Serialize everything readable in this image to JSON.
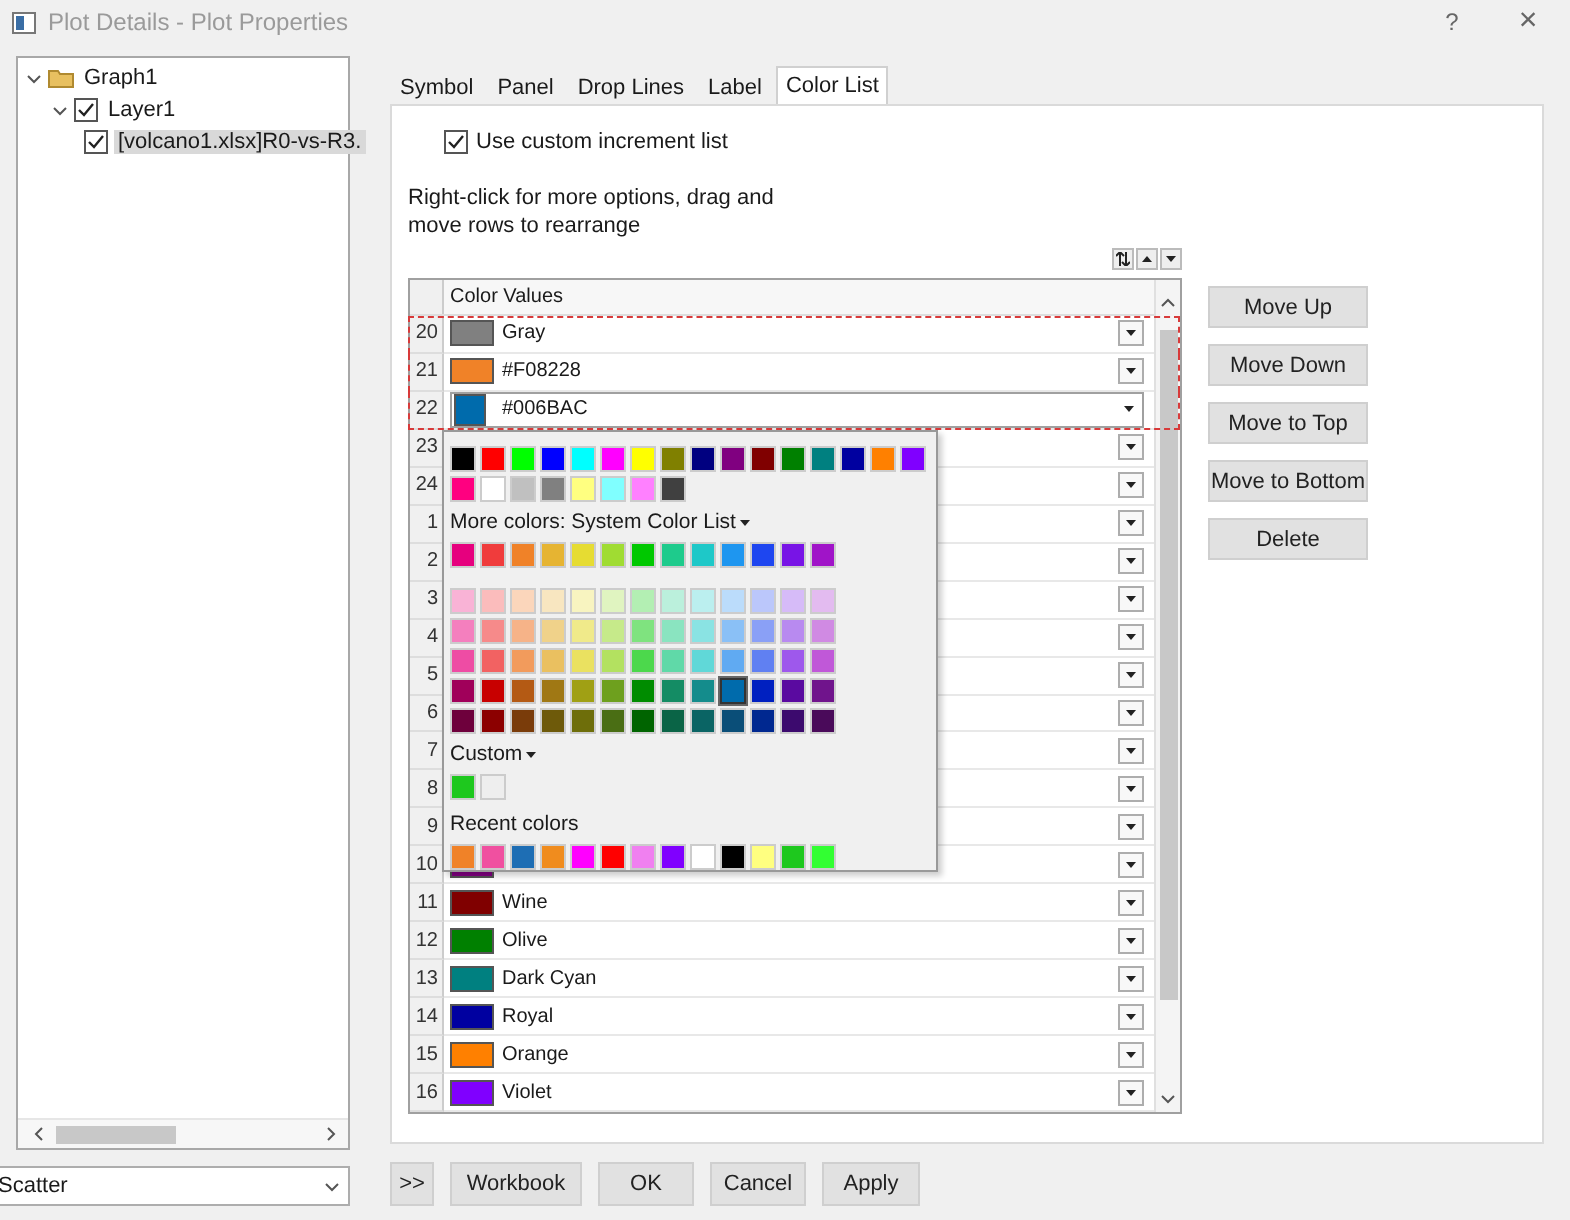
{
  "window": {
    "title": "Plot Details - Plot Properties",
    "buttons": [
      {
        "kind": "help",
        "label": "?"
      },
      {
        "kind": "close",
        "label": "×"
      }
    ]
  },
  "tree": [
    {
      "label": "Graph1",
      "kind": "folder",
      "expanded": true,
      "selected": false,
      "children": [
        {
          "label": "Layer1",
          "kind": "check",
          "checked": true,
          "expanded": true,
          "selected": false,
          "children": [
            {
              "label": "[volcano1.xlsx]R0-vs-R3.",
              "kind": "check",
              "checked": true,
              "selected": true
            }
          ]
        }
      ]
    }
  ],
  "plot_type": {
    "value": "Scatter"
  },
  "tabs": [
    {
      "label": "Symbol",
      "selected": false
    },
    {
      "label": "Panel",
      "selected": false
    },
    {
      "label": "Drop Lines",
      "selected": false
    },
    {
      "label": "Label",
      "selected": false
    },
    {
      "label": "Color List",
      "selected": true
    }
  ],
  "use_custom_increment": {
    "label": "Use custom increment list",
    "checked": true
  },
  "hint": "Right-click for more options, drag and move rows to rearrange",
  "table": {
    "header": "Color Values",
    "rows": [
      {
        "number": "20",
        "name": "Gray",
        "color": "#808080",
        "selected": true,
        "open": false
      },
      {
        "number": "21",
        "name": "#F08228",
        "color": "#f08228",
        "selected": true,
        "open": false
      },
      {
        "number": "22",
        "name": "#006BAC",
        "color": "#006bac",
        "selected": true,
        "open": true
      },
      {
        "number": "23",
        "selected": false,
        "open": false
      },
      {
        "number": "24",
        "selected": false,
        "open": false
      },
      {
        "number": "1",
        "selected": false,
        "open": false
      },
      {
        "number": "2",
        "selected": false,
        "open": false
      },
      {
        "number": "3",
        "selected": false,
        "open": false
      },
      {
        "number": "4",
        "selected": false,
        "open": false
      },
      {
        "number": "5",
        "selected": false,
        "open": false
      },
      {
        "number": "6",
        "selected": false,
        "open": false
      },
      {
        "number": "7",
        "selected": false,
        "open": false
      },
      {
        "number": "8",
        "selected": false,
        "open": false
      },
      {
        "number": "9",
        "selected": false,
        "open": false
      },
      {
        "number": "10",
        "color": "#800080",
        "selected": false,
        "open": false
      },
      {
        "number": "11",
        "name": "Wine",
        "color": "#800000",
        "selected": false,
        "open": false
      },
      {
        "number": "12",
        "name": "Olive",
        "color": "#008000",
        "selected": false,
        "open": false
      },
      {
        "number": "13",
        "name": "Dark Cyan",
        "color": "#008080",
        "selected": false,
        "open": false
      },
      {
        "number": "14",
        "name": "Royal",
        "color": "#0000a0",
        "selected": false,
        "open": false
      },
      {
        "number": "15",
        "name": "Orange",
        "color": "#ff8000",
        "selected": false,
        "open": false
      },
      {
        "number": "16",
        "name": "Violet",
        "color": "#8000ff",
        "selected": false,
        "open": false
      }
    ]
  },
  "color_popup": {
    "standard": [
      [
        {
          "color": "#000000",
          "selected": false
        },
        {
          "color": "#ff0000",
          "selected": false
        },
        {
          "color": "#00ff00",
          "selected": false
        },
        {
          "color": "#0000ff",
          "selected": false
        },
        {
          "color": "#00ffff",
          "selected": false
        },
        {
          "color": "#ff00ff",
          "selected": false
        },
        {
          "color": "#ffff00",
          "selected": false
        },
        {
          "color": "#808000",
          "selected": false
        },
        {
          "color": "#000080",
          "selected": false
        },
        {
          "color": "#800080",
          "selected": false
        },
        {
          "color": "#800000",
          "selected": false
        },
        {
          "color": "#008000",
          "selected": false
        },
        {
          "color": "#008080",
          "selected": false
        },
        {
          "color": "#0000a0",
          "selected": false
        },
        {
          "color": "#ff8000",
          "selected": false
        },
        {
          "color": "#8000ff",
          "selected": false
        }
      ],
      [
        {
          "color": "#ff0080",
          "selected": false
        },
        {
          "color": "#ffffff",
          "selected": false
        },
        {
          "color": "#c0c0c0",
          "selected": false
        },
        {
          "color": "#808080",
          "selected": false
        },
        {
          "color": "#ffff80",
          "selected": false
        },
        {
          "color": "#80ffff",
          "selected": false
        },
        {
          "color": "#ff80ff",
          "selected": false
        },
        {
          "color": "#404040",
          "selected": false
        }
      ]
    ],
    "more_label": "More colors: System Color List",
    "system": [
      [
        {
          "color": "#e6007e",
          "selected": false
        },
        {
          "color": "#f03c3c",
          "selected": false
        },
        {
          "color": "#f08228",
          "selected": false
        },
        {
          "color": "#e6b432",
          "selected": false
        },
        {
          "color": "#e6dc32",
          "selected": false
        },
        {
          "color": "#a0dc32",
          "selected": false
        },
        {
          "color": "#00c800",
          "selected": false
        },
        {
          "color": "#1ecb8c",
          "selected": false
        },
        {
          "color": "#1ec8c8",
          "selected": false
        },
        {
          "color": "#1e96f0",
          "selected": false
        },
        {
          "color": "#1e46f0",
          "selected": false
        },
        {
          "color": "#7814e6",
          "selected": false
        },
        {
          "color": "#a014c8",
          "selected": false
        }
      ],
      [
        {
          "color": "#f9b3d6",
          "selected": false
        },
        {
          "color": "#fbbcbc",
          "selected": false
        },
        {
          "color": "#fbd6bb",
          "selected": false
        },
        {
          "color": "#f8e6c0",
          "selected": false
        },
        {
          "color": "#f8f4c0",
          "selected": false
        },
        {
          "color": "#e0f4c0",
          "selected": false
        },
        {
          "color": "#b3efb3",
          "selected": false
        },
        {
          "color": "#bbf0dc",
          "selected": false
        },
        {
          "color": "#bbefef",
          "selected": false
        },
        {
          "color": "#bbdcfb",
          "selected": false
        },
        {
          "color": "#bbc7fb",
          "selected": false
        },
        {
          "color": "#d6bbf8",
          "selected": false
        },
        {
          "color": "#e3bbf0",
          "selected": false
        }
      ],
      [
        {
          "color": "#f47fbe",
          "selected": false
        },
        {
          "color": "#f68a8a",
          "selected": false
        },
        {
          "color": "#f6b388",
          "selected": false
        },
        {
          "color": "#f0d28a",
          "selected": false
        },
        {
          "color": "#f0ea8a",
          "selected": false
        },
        {
          "color": "#c6ea8a",
          "selected": false
        },
        {
          "color": "#7fe37f",
          "selected": false
        },
        {
          "color": "#8ae4c0",
          "selected": false
        },
        {
          "color": "#8ae3e3",
          "selected": false
        },
        {
          "color": "#8ac0f6",
          "selected": false
        },
        {
          "color": "#8aa0f6",
          "selected": false
        },
        {
          "color": "#b88af0",
          "selected": false
        },
        {
          "color": "#d08ae3",
          "selected": false
        }
      ],
      [
        {
          "color": "#ee4ca4",
          "selected": false
        },
        {
          "color": "#f26262",
          "selected": false
        },
        {
          "color": "#f29b5c",
          "selected": false
        },
        {
          "color": "#eac060",
          "selected": false
        },
        {
          "color": "#eae160",
          "selected": false
        },
        {
          "color": "#b3e160",
          "selected": false
        },
        {
          "color": "#4cd84c",
          "selected": false
        },
        {
          "color": "#60d9a8",
          "selected": false
        },
        {
          "color": "#60d8d8",
          "selected": false
        },
        {
          "color": "#60aaf2",
          "selected": false
        },
        {
          "color": "#6080f2",
          "selected": false
        },
        {
          "color": "#9e58ec",
          "selected": false
        },
        {
          "color": "#c058d8",
          "selected": false
        }
      ],
      [
        {
          "color": "#a0005a",
          "selected": false
        },
        {
          "color": "#c80000",
          "selected": false
        },
        {
          "color": "#b45a14",
          "selected": false
        },
        {
          "color": "#a07814",
          "selected": false
        },
        {
          "color": "#a0a014",
          "selected": false
        },
        {
          "color": "#6ea01e",
          "selected": false
        },
        {
          "color": "#008c00",
          "selected": false
        },
        {
          "color": "#148c64",
          "selected": false
        },
        {
          "color": "#148c8c",
          "selected": false
        },
        {
          "color": "#006bac",
          "selected": true
        },
        {
          "color": "#0020c0",
          "selected": false
        },
        {
          "color": "#5a0aa0",
          "selected": false
        },
        {
          "color": "#70148c",
          "selected": false
        }
      ],
      [
        {
          "color": "#6e003c",
          "selected": false
        },
        {
          "color": "#8c0000",
          "selected": false
        },
        {
          "color": "#7a3c0a",
          "selected": false
        },
        {
          "color": "#6e5a0a",
          "selected": false
        },
        {
          "color": "#6e6e0a",
          "selected": false
        },
        {
          "color": "#4a6e14",
          "selected": false
        },
        {
          "color": "#006400",
          "selected": false
        },
        {
          "color": "#0a6446",
          "selected": false
        },
        {
          "color": "#0a6464",
          "selected": false
        },
        {
          "color": "#0a4e78",
          "selected": false
        },
        {
          "color": "#002890",
          "selected": false
        },
        {
          "color": "#3c0a6e",
          "selected": false
        },
        {
          "color": "#4a0a5a",
          "selected": false
        }
      ]
    ],
    "custom_label": "Custom",
    "custom": [
      {
        "color": "#1ec81e",
        "selected": false
      },
      {
        "color": "#eeeeee",
        "selected": false
      }
    ],
    "recent_label": "Recent colors",
    "recent": [
      {
        "color": "#f08228",
        "selected": false
      },
      {
        "color": "#f050a0",
        "selected": false
      },
      {
        "color": "#1e6eb4",
        "selected": false
      },
      {
        "color": "#f08c1e",
        "selected": false
      },
      {
        "color": "#ff00ff",
        "selected": false
      },
      {
        "color": "#ff0000",
        "selected": false
      },
      {
        "color": "#f080f0",
        "selected": false
      },
      {
        "color": "#8000ff",
        "selected": false
      },
      {
        "color": "#ffffff",
        "selected": false
      },
      {
        "color": "#000000",
        "selected": false
      },
      {
        "color": "#ffff80",
        "selected": false
      },
      {
        "color": "#1ec81e",
        "selected": false
      },
      {
        "color": "#32ff32",
        "selected": false
      }
    ]
  },
  "side_buttons": [
    "Move Up",
    "Move Down",
    "Move to Top",
    "Move to Bottom",
    "Delete"
  ],
  "footer_buttons": [
    ">>",
    "Workbook",
    "OK",
    "Cancel",
    "Apply"
  ]
}
